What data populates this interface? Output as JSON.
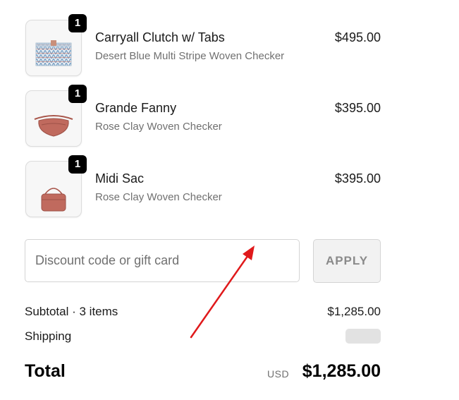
{
  "items": [
    {
      "name": "Carryall Clutch w/ Tabs",
      "variant": "Desert Blue Multi Stripe Woven Checker",
      "price": "$495.00",
      "quantity": "1",
      "thumbnail_icon": "woven-clutch-image"
    },
    {
      "name": "Grande Fanny",
      "variant": "Rose Clay Woven Checker",
      "price": "$395.00",
      "quantity": "1",
      "thumbnail_icon": "fanny-pack-image"
    },
    {
      "name": "Midi Sac",
      "variant": "Rose Clay Woven Checker",
      "price": "$395.00",
      "quantity": "1",
      "thumbnail_icon": "midi-sac-image"
    }
  ],
  "discount": {
    "placeholder": "Discount code or gift card",
    "value": "",
    "apply_label": "APPLY"
  },
  "summary": {
    "subtotal_label": "Subtotal · 3 items",
    "subtotal_value": "$1,285.00",
    "shipping_label": "Shipping",
    "total_label": "Total",
    "currency": "USD",
    "total_value": "$1,285.00"
  },
  "colors": {
    "quantity_badge": "#000000",
    "apply_button_bg": "#f2f2f2",
    "annotation_arrow": "#e0191b",
    "product_rose_clay": "#c06a5e",
    "product_desert_blue": "#7fa6c9"
  }
}
